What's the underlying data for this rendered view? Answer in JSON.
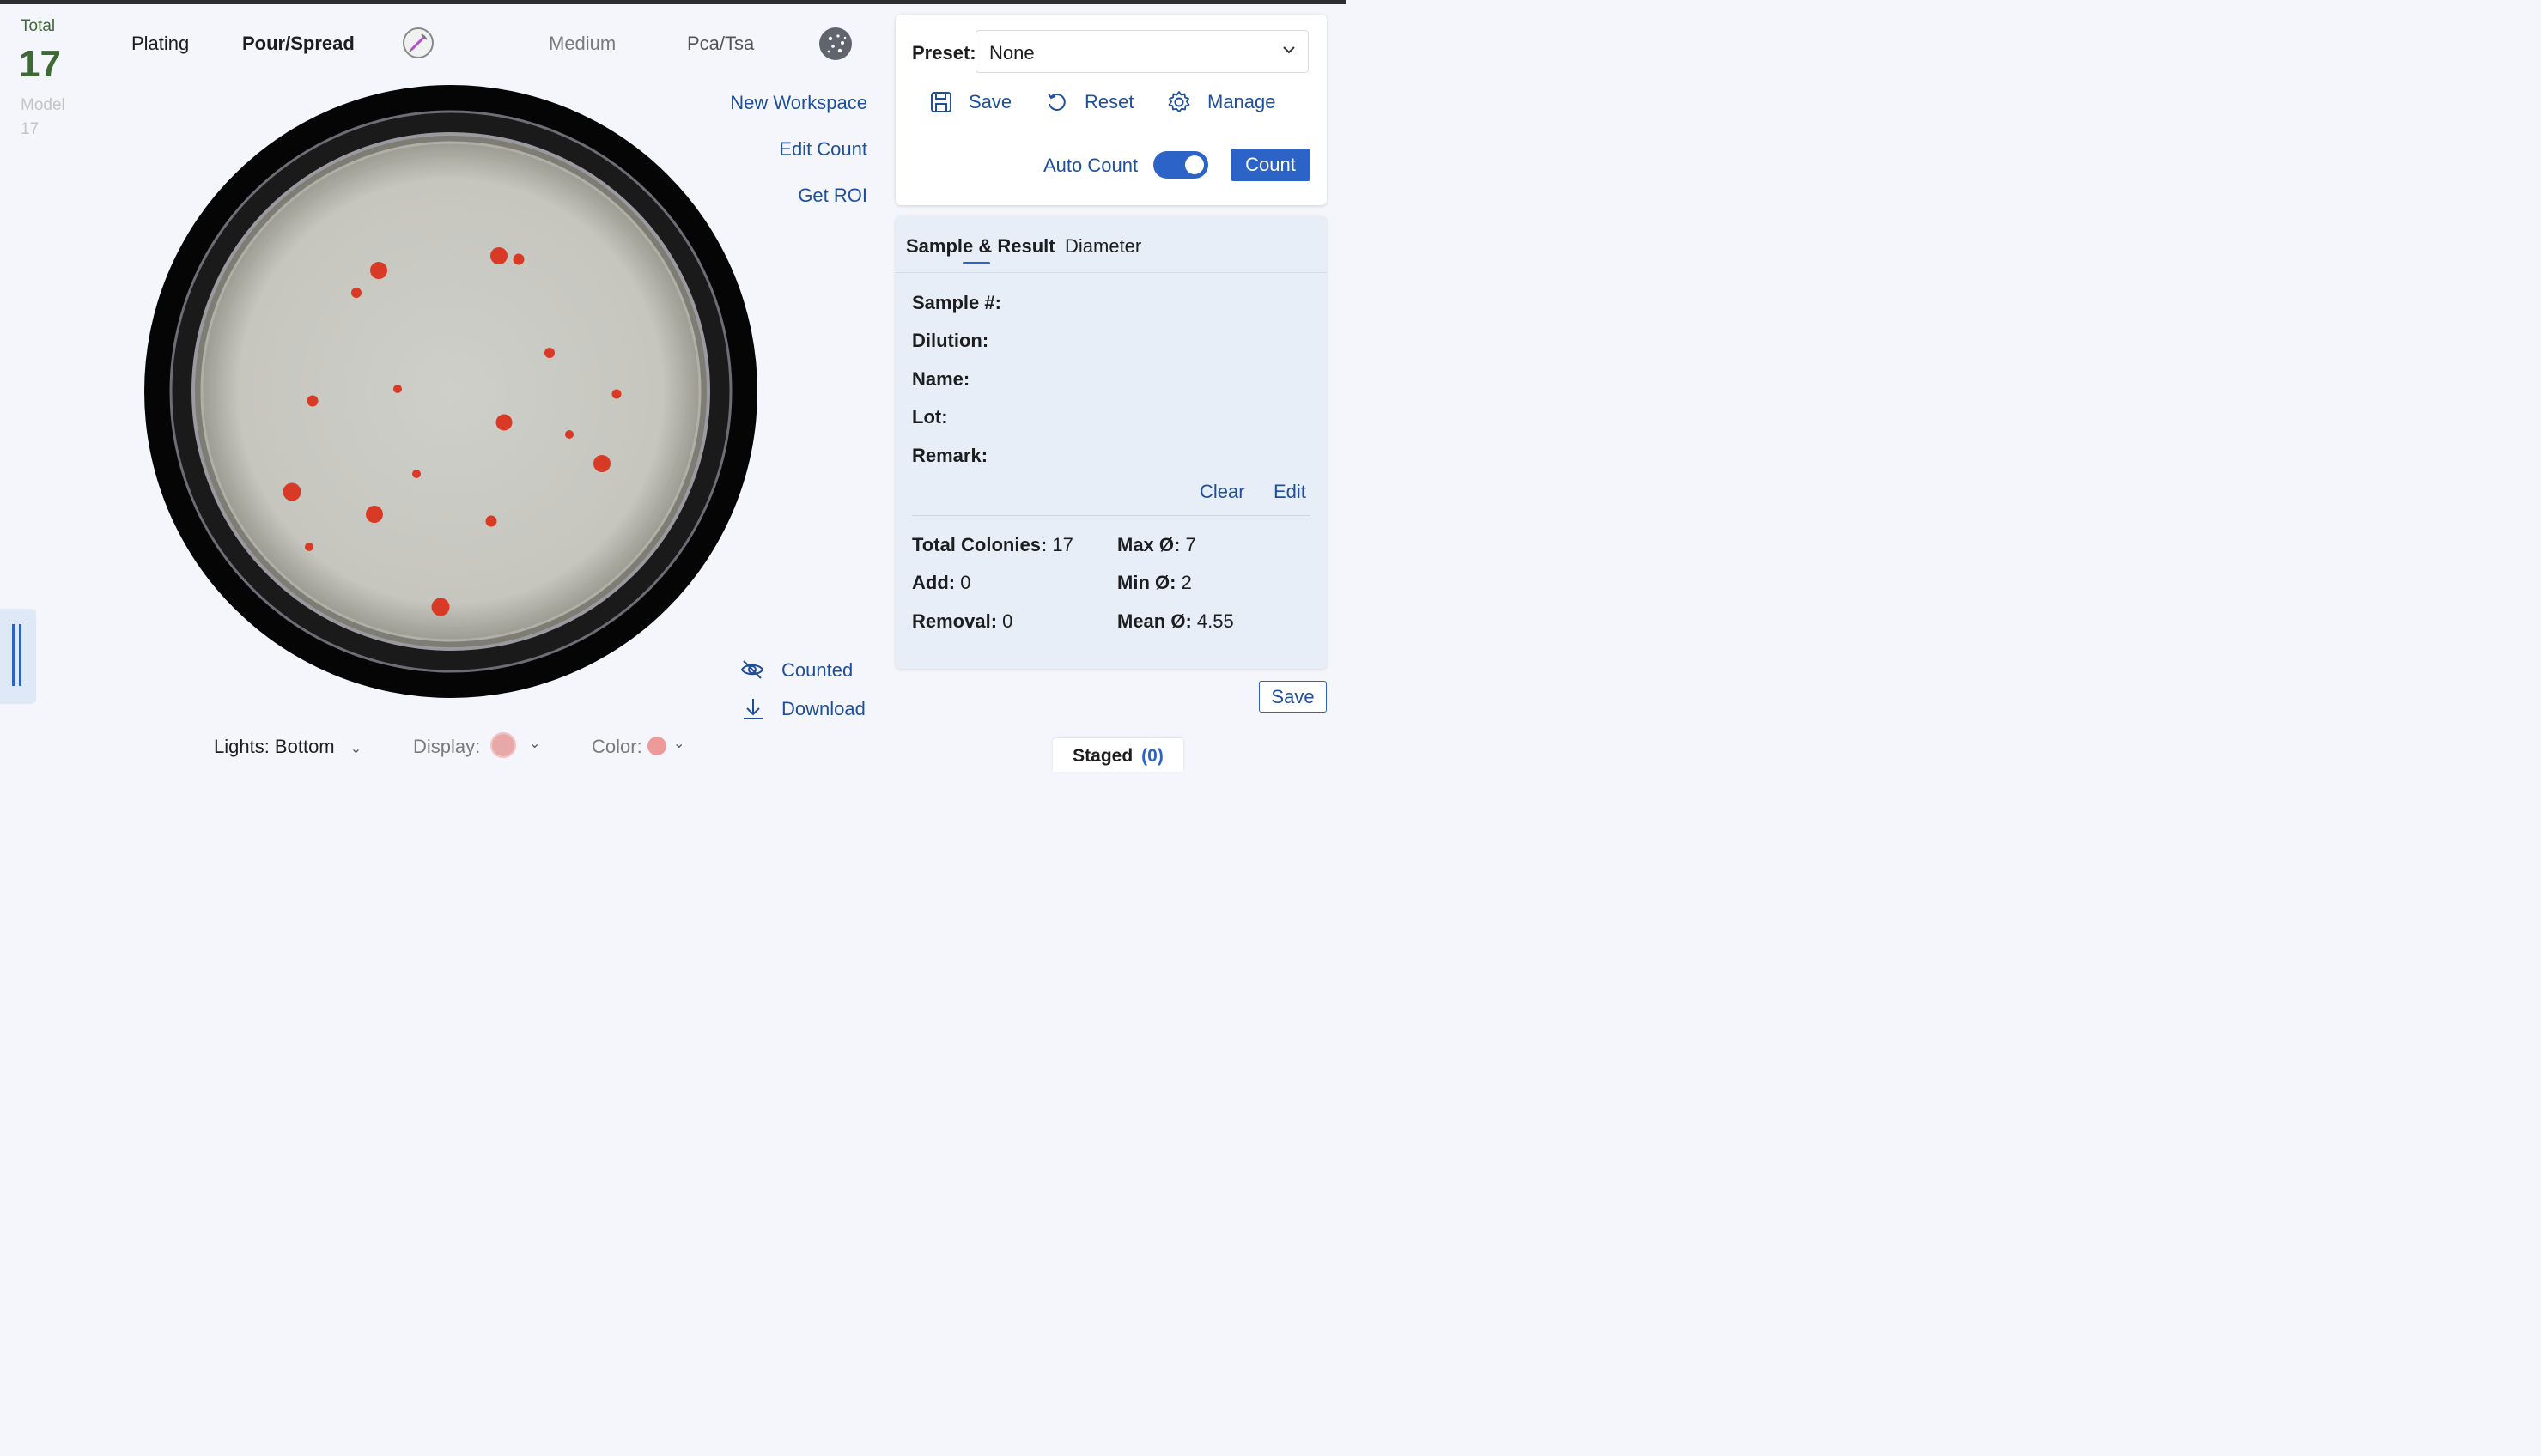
{
  "stats": {
    "total_label": "Total",
    "total_value": "17",
    "model_label": "Model",
    "model_value": "17"
  },
  "header": {
    "plating": "Plating",
    "method": "Pour/Spread",
    "medium": "Medium",
    "media_type": "Pca/Tsa"
  },
  "workspace_actions": {
    "new_workspace": "New Workspace",
    "edit_count": "Edit Count",
    "get_roi": "Get ROI"
  },
  "image_actions": {
    "counted": "Counted",
    "download": "Download"
  },
  "bottom_controls": {
    "lights": "Lights: Bottom",
    "display": "Display:",
    "color": "Color:"
  },
  "preset": {
    "label": "Preset:",
    "value": "None",
    "save": "Save",
    "reset": "Reset",
    "manage": "Manage",
    "auto_count": "Auto Count",
    "auto_count_on": true,
    "count": "Count"
  },
  "results": {
    "tabs": [
      "Sample & Result",
      "Diameter"
    ],
    "fields": [
      "Sample #:",
      "Dilution:",
      "Name:",
      "Lot:",
      "Remark:"
    ],
    "clear": "Clear",
    "edit": "Edit",
    "total_colonies_label": "Total Colonies:",
    "total_colonies": "17",
    "add_label": "Add:",
    "add": "0",
    "removal_label": "Removal:",
    "removal": "0",
    "max_label": "Max Ø:",
    "max": "7",
    "min_label": "Min Ø:",
    "min": "2",
    "mean_label": "Mean Ø:",
    "mean": "4.55"
  },
  "save_button": "Save",
  "staged": {
    "label": "Staged",
    "count": "(0)"
  },
  "colors": {
    "accent": "#2c63c7",
    "link": "#1e4f9c",
    "total_green": "#3e6b35",
    "colony_red": "#d83a25"
  }
}
